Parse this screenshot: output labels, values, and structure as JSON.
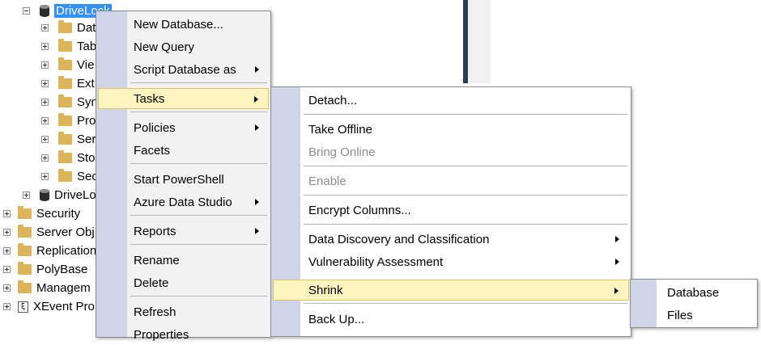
{
  "tree": {
    "selected_db": "DriveLock",
    "db_children": [
      "Dat",
      "Tab",
      "Vie",
      "Ext",
      "Syn",
      "Pro",
      "Ser",
      "Sto",
      "Sec"
    ],
    "second_db": "DriveLo",
    "server_nodes": [
      "Security",
      "Server Obj",
      "Replication",
      "PolyBase",
      "Managem",
      "XEvent Pro"
    ]
  },
  "context_menu": {
    "items": [
      "New Database...",
      "New Query",
      "Script Database as",
      "Tasks",
      "Policies",
      "Facets",
      "Start PowerShell",
      "Azure Data Studio",
      "Reports",
      "Rename",
      "Delete",
      "Refresh",
      "Properties"
    ]
  },
  "tasks_menu": {
    "items": [
      "Detach...",
      "Take Offline",
      "Bring Online",
      "Enable",
      "Encrypt Columns...",
      "Data Discovery and Classification",
      "Vulnerability Assessment",
      "Shrink",
      "Back Up..."
    ]
  },
  "shrink_menu": {
    "items": [
      "Database",
      "Files"
    ]
  },
  "colors": {
    "highlight": "#fdf4bf",
    "selection": "#3390ff",
    "folder": "#dcb45a",
    "gutter": "#cdd5e6"
  }
}
